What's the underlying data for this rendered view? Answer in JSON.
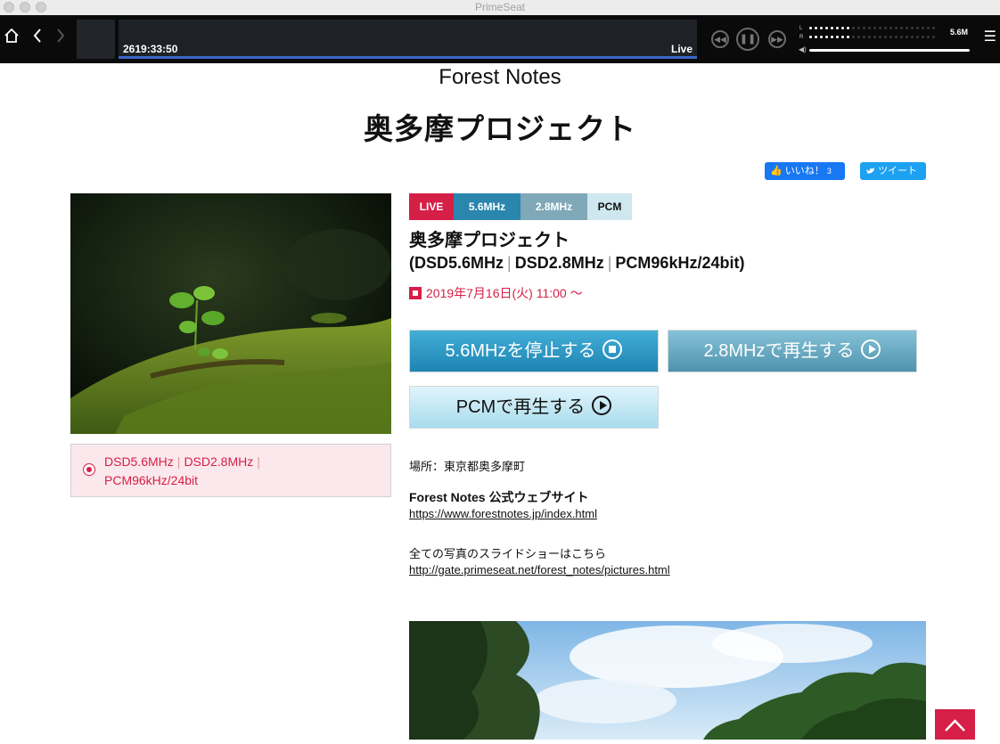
{
  "app": {
    "title": "PrimeSeat"
  },
  "player": {
    "time": "2619:33:50",
    "status": "Live",
    "progress": 1.0,
    "rate": "5.6M",
    "meter_left_label": "L",
    "meter_right_label": "R",
    "meter_left_level": 0.33,
    "meter_right_level": 0.33,
    "volume": 1.0
  },
  "header": {
    "brand": "Forest Notes",
    "title": "奥多摩プロジェクト",
    "like_label": "いいね！",
    "like_count": "3",
    "tweet_label": "ツイート"
  },
  "formats": {
    "items": [
      "DSD5.6MHz",
      "DSD2.8MHz",
      "PCM96kHz/24bit"
    ],
    "separator": "|"
  },
  "badges": [
    {
      "label": "LIVE",
      "color": "#d61f47",
      "text_color": "#ffffff"
    },
    {
      "label": "5.6MHz",
      "color": "#2a86ad",
      "text_color": "#ffffff"
    },
    {
      "label": "2.8MHz",
      "color": "#7fa8b8",
      "text_color": "#ffffff"
    },
    {
      "label": "PCM",
      "color": "#cfe7ef",
      "text_color": "#111111"
    }
  ],
  "event": {
    "title": "奥多摩プロジェクト",
    "formats": [
      "(DSD5.6MHz",
      "DSD2.8MHz",
      "PCM96kHz/24bit)"
    ],
    "date": "2019年7月16日(火) 11:00 〜"
  },
  "buttons": {
    "stop_56": "5.6MHzを停止する",
    "play_28": "2.8MHzで再生する",
    "play_pcm": "PCMで再生する"
  },
  "info": {
    "location": "場所：東京都奥多摩町",
    "site_heading": "Forest Notes 公式ウェブサイト",
    "site_url": "https://www.forestnotes.jp/index.html",
    "slideshow_text": "全ての写真のスライドショーはこちら",
    "slideshow_url": "http://gate.primeseat.net/forest_notes/pictures.html"
  },
  "colors": {
    "accent": "#d61f47",
    "player_bg": "#0a0a0a",
    "progress": "#3a67c8",
    "btn_active": "#2a93c2",
    "btn_secondary": "#62a9c4",
    "btn_pcm": "#bfe6f3"
  },
  "icons": {
    "home": "home-icon",
    "back": "back-arrow-icon",
    "forward": "forward-arrow-icon",
    "rewind": "rewind-icon",
    "pause": "pause-icon",
    "fast_forward": "fast-forward-icon",
    "volume": "volume-icon",
    "menu": "menu-icon",
    "like": "thumbs-up-icon",
    "tweet": "twitter-bird-icon",
    "stop": "stop-circle-icon",
    "play": "play-circle-icon",
    "scroll_top": "chevron-up-icon"
  }
}
